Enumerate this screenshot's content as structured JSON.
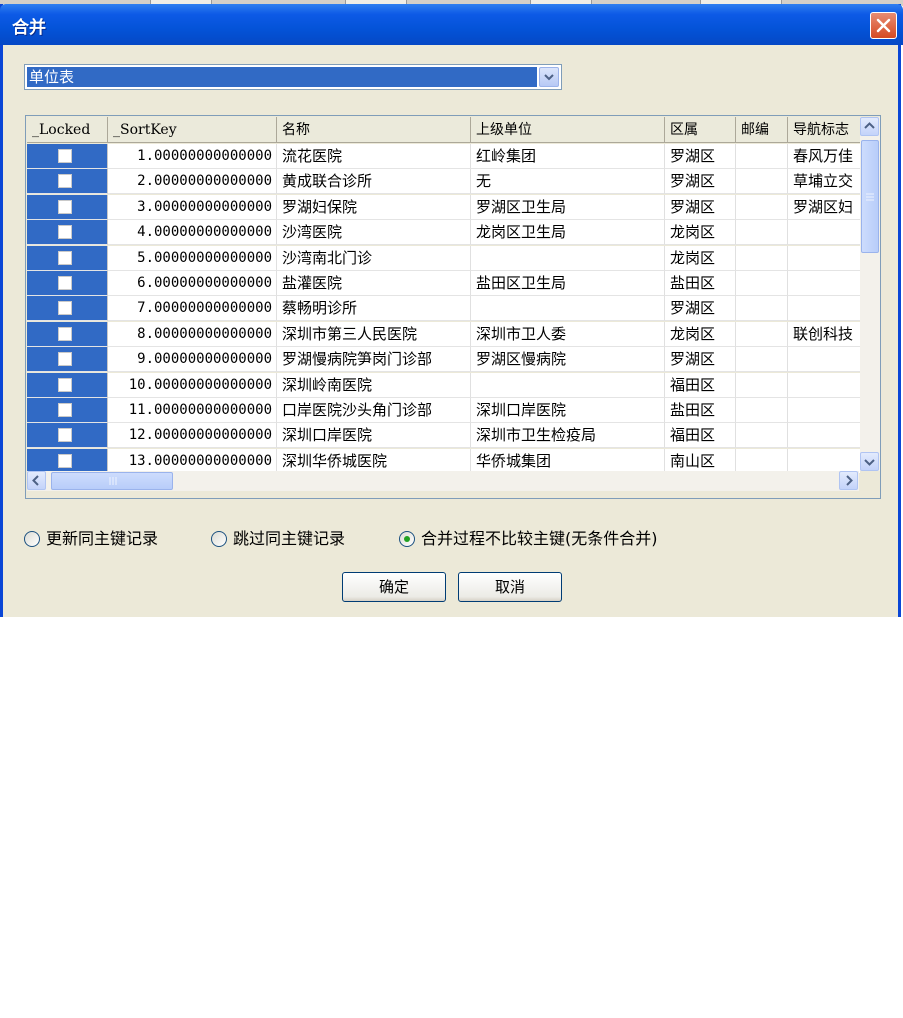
{
  "window": {
    "title": "合并"
  },
  "icons": {
    "close": "close-x-icon",
    "dropdown": "chevron-down-icon",
    "scroll_up": "arrow-up-icon",
    "scroll_down": "arrow-down-icon",
    "scroll_left": "arrow-left-icon",
    "scroll_right": "arrow-right-icon"
  },
  "colors": {
    "title_bar": "#0453d8",
    "selection": "#316ac5",
    "close_button": "#d54a22",
    "dialog_bg": "#ece9d8"
  },
  "table_selector": {
    "selected": "单位表"
  },
  "grid": {
    "columns": [
      "_Locked",
      "_SortKey",
      "名称",
      "上级单位",
      "区属",
      "邮编",
      "导航标志"
    ],
    "rows": [
      {
        "locked": false,
        "sortkey": "1.00000000000000",
        "name": "流花医院",
        "parent": "红岭集团",
        "district": "罗湖区",
        "zip": "",
        "nav": "春风万佳"
      },
      {
        "locked": false,
        "sortkey": "2.00000000000000",
        "name": "黄成联合诊所",
        "parent": "无",
        "district": "罗湖区",
        "zip": "",
        "nav": "草埔立交"
      },
      {
        "locked": false,
        "sortkey": "3.00000000000000",
        "name": "罗湖妇保院",
        "parent": "罗湖区卫生局",
        "district": "罗湖区",
        "zip": "",
        "nav": "罗湖区妇"
      },
      {
        "locked": false,
        "sortkey": "4.00000000000000",
        "name": "沙湾医院",
        "parent": "龙岗区卫生局",
        "district": "龙岗区",
        "zip": "",
        "nav": ""
      },
      {
        "locked": false,
        "sortkey": "5.00000000000000",
        "name": "沙湾南北门诊",
        "parent": "",
        "district": "龙岗区",
        "zip": "",
        "nav": ""
      },
      {
        "locked": false,
        "sortkey": "6.00000000000000",
        "name": "盐灌医院",
        "parent": "盐田区卫生局",
        "district": "盐田区",
        "zip": "",
        "nav": ""
      },
      {
        "locked": false,
        "sortkey": "7.00000000000000",
        "name": "蔡畅明诊所",
        "parent": "",
        "district": "罗湖区",
        "zip": "",
        "nav": ""
      },
      {
        "locked": false,
        "sortkey": "8.00000000000000",
        "name": "深圳市第三人民医院",
        "parent": "深圳市卫人委",
        "district": "龙岗区",
        "zip": "",
        "nav": "联创科技"
      },
      {
        "locked": false,
        "sortkey": "9.00000000000000",
        "name": "罗湖慢病院笋岗门诊部",
        "parent": "罗湖区慢病院",
        "district": "罗湖区",
        "zip": "",
        "nav": ""
      },
      {
        "locked": false,
        "sortkey": "10.00000000000000",
        "name": "深圳岭南医院",
        "parent": "",
        "district": "福田区",
        "zip": "",
        "nav": ""
      },
      {
        "locked": false,
        "sortkey": "11.00000000000000",
        "name": "口岸医院沙头角门诊部",
        "parent": "深圳口岸医院",
        "district": "盐田区",
        "zip": "",
        "nav": ""
      },
      {
        "locked": false,
        "sortkey": "12.00000000000000",
        "name": "深圳口岸医院",
        "parent": "深圳市卫生检疫局",
        "district": "福田区",
        "zip": "",
        "nav": ""
      },
      {
        "locked": false,
        "sortkey": "13.00000000000000",
        "name": "深圳华侨城医院",
        "parent": "华侨城集团",
        "district": "南山区",
        "zip": "",
        "nav": ""
      }
    ]
  },
  "options": [
    {
      "label": "更新同主键记录",
      "selected": false
    },
    {
      "label": "跳过同主键记录",
      "selected": false
    },
    {
      "label": "合并过程不比较主键(无条件合并)",
      "selected": true
    }
  ],
  "buttons": {
    "ok": "确定",
    "cancel": "取消"
  }
}
